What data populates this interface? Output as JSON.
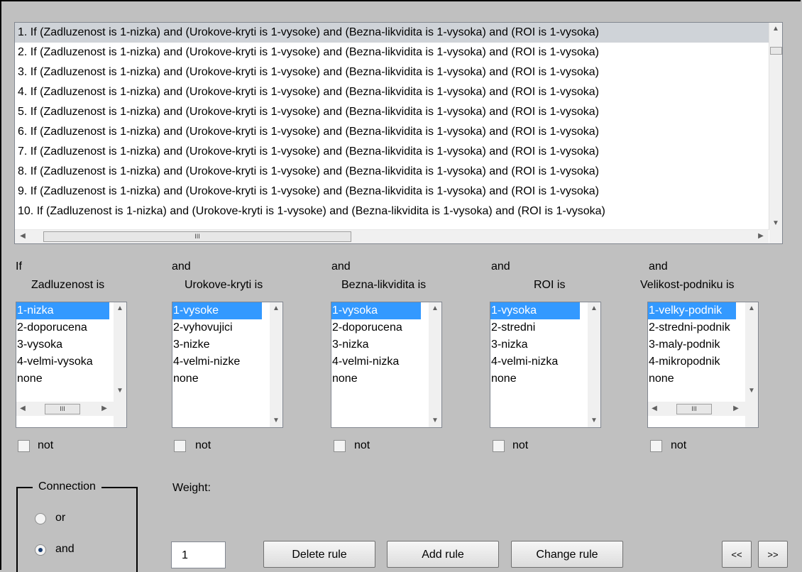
{
  "rules": [
    "1. If (Zadluzenost is 1-nizka) and (Urokove-kryti is 1-vysoke) and (Bezna-likvidita is 1-vysoka) and (ROI is 1-vysoka)",
    "2. If (Zadluzenost is 1-nizka) and (Urokove-kryti is 1-vysoke) and (Bezna-likvidita is 1-vysoka) and (ROI is 1-vysoka)",
    "3. If (Zadluzenost is 1-nizka) and (Urokove-kryti is 1-vysoke) and (Bezna-likvidita is 1-vysoka) and (ROI is 1-vysoka)",
    "4. If (Zadluzenost is 1-nizka) and (Urokove-kryti is 1-vysoke) and (Bezna-likvidita is 1-vysoka) and (ROI is 1-vysoka)",
    "5. If (Zadluzenost is 1-nizka) and (Urokove-kryti is 1-vysoke) and (Bezna-likvidita is 1-vysoka) and (ROI is 1-vysoka)",
    "6. If (Zadluzenost is 1-nizka) and (Urokove-kryti is 1-vysoke) and (Bezna-likvidita is 1-vysoka) and (ROI is 1-vysoka)",
    "7. If (Zadluzenost is 1-nizka) and (Urokove-kryti is 1-vysoke) and (Bezna-likvidita is 1-vysoka) and (ROI is 1-vysoka)",
    "8. If (Zadluzenost is 1-nizka) and (Urokove-kryti is 1-vysoke) and (Bezna-likvidita is 1-vysoka) and (ROI is 1-vysoka)",
    "9. If (Zadluzenost is 1-nizka) and (Urokove-kryti is 1-vysoke) and (Bezna-likvidita is 1-vysoka) and (ROI is 1-vysoka)",
    "10. If (Zadluzenost is 1-nizka) and (Urokove-kryti is 1-vysoke) and (Bezna-likvidita is 1-vysoka) and (ROI is 1-vysoka)"
  ],
  "scroll_grip": "III",
  "columns": [
    {
      "connector": "If",
      "title": "Zadluzenost is",
      "options": [
        "1-nizka",
        "2-doporucena",
        "3-vysoka",
        "4-velmi-vysoka",
        "none"
      ],
      "not_label": "not"
    },
    {
      "connector": "and",
      "title": "Urokove-kryti is",
      "options": [
        "1-vysoke",
        "2-vyhovujici",
        "3-nizke",
        "4-velmi-nizke",
        "none"
      ],
      "not_label": "not"
    },
    {
      "connector": "and",
      "title": "Bezna-likvidita is",
      "options": [
        "1-vysoka",
        "2-doporucena",
        "3-nizka",
        "4-velmi-nizka",
        "none"
      ],
      "not_label": "not"
    },
    {
      "connector": "and",
      "title": "ROI is",
      "options": [
        "1-vysoka",
        "2-stredni",
        "3-nizka",
        "4-velmi-nizka",
        "none"
      ],
      "not_label": "not"
    },
    {
      "connector": "and",
      "title": "Velikost-podniku is",
      "options": [
        "1-velky-podnik",
        "2-stredni-podnik",
        "3-maly-podnik",
        "4-mikropodnik",
        "none"
      ],
      "not_label": "not"
    }
  ],
  "connection": {
    "title": "Connection",
    "or_label": "or",
    "and_label": "and",
    "selected": "and"
  },
  "weight": {
    "label": "Weight:",
    "value": "1"
  },
  "buttons": {
    "delete": "Delete rule",
    "add": "Add rule",
    "change": "Change rule",
    "prev": "<<",
    "next": ">>"
  }
}
